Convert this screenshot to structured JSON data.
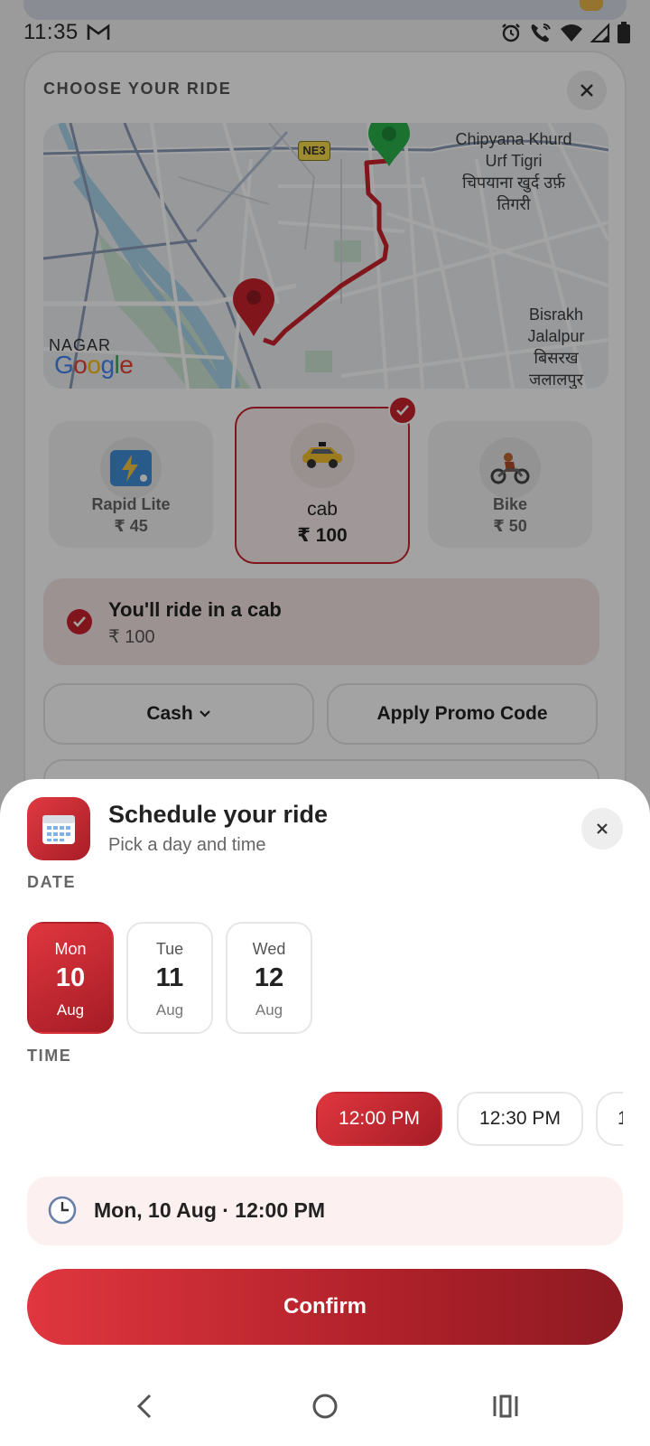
{
  "status_bar": {
    "time": "11:35",
    "icons": [
      "gmail-icon",
      "alarm-icon",
      "wifi-calling-icon",
      "wifi-icon",
      "signal-icon",
      "battery-icon"
    ]
  },
  "ride_card": {
    "title": "CHOOSE YOUR RIDE",
    "map": {
      "places": [
        "Chipyana Khurd Urf Tigri",
        "चिपयाना खुर्द उर्फ़ तिगरी",
        "Bisrakh Jalalpur",
        "बिसरख जलालपुर",
        "NAGAR"
      ],
      "road_badge": "NE3",
      "attribution": "Google"
    },
    "options": [
      {
        "name": "Rapid Lite",
        "price": "₹ 45",
        "icon": "rapid-lite-icon",
        "selected": false
      },
      {
        "name": "cab",
        "price": "₹ 100",
        "icon": "cab-icon",
        "selected": true
      },
      {
        "name": "Bike",
        "price": "₹ 50",
        "icon": "bike-icon",
        "selected": false
      }
    ],
    "selection_info": {
      "title": "You'll ride in a cab",
      "price": "₹ 100"
    },
    "payment_label": "Cash",
    "promo_label": "Apply Promo Code"
  },
  "sheet": {
    "title": "Schedule your ride",
    "subtitle": "Pick a day and time",
    "date_label": "DATE",
    "dates": [
      {
        "day": "Mon",
        "num": "10",
        "month": "Aug",
        "selected": true
      },
      {
        "day": "Tue",
        "num": "11",
        "month": "Aug",
        "selected": false
      },
      {
        "day": "Wed",
        "num": "12",
        "month": "Aug",
        "selected": false
      }
    ],
    "time_label": "TIME",
    "times": [
      {
        "label": "12:00 PM",
        "selected": true
      },
      {
        "label": "12:30 PM",
        "selected": false
      },
      {
        "label": "1",
        "selected": false
      }
    ],
    "summary": "Mon, 10 Aug  ·  12:00 PM",
    "confirm_label": "Confirm"
  },
  "colors": {
    "accent": "#c8232d",
    "accent_dark": "#8e1a22",
    "route": "#c8232d",
    "destination_pin": "#2bb24c"
  }
}
